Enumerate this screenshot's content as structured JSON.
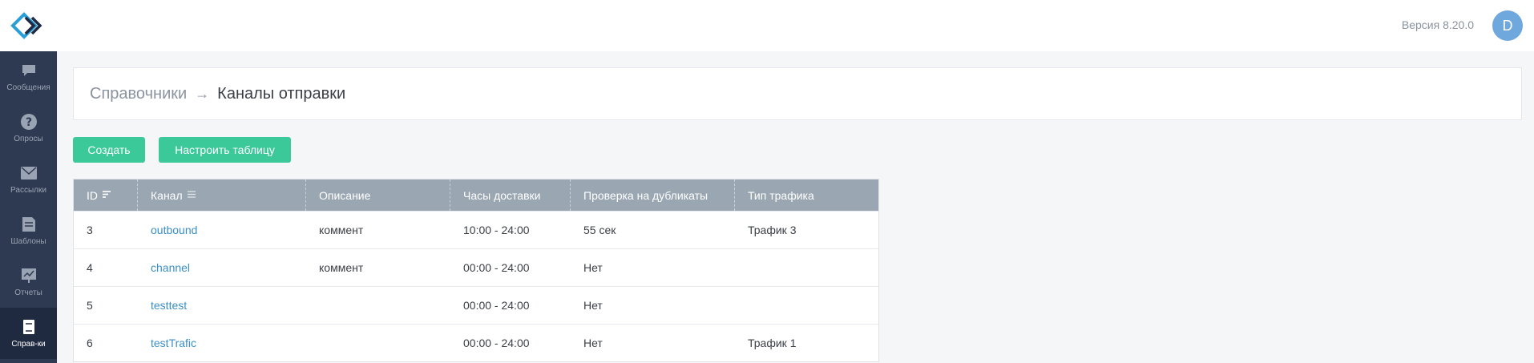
{
  "sidebar": {
    "items": [
      {
        "label": "Сообщения",
        "icon": "chat-bubble-icon"
      },
      {
        "label": "Опросы",
        "icon": "question-circle-icon"
      },
      {
        "label": "Рассылки",
        "icon": "envelope-icon"
      },
      {
        "label": "Шаблоны",
        "icon": "document-icon"
      },
      {
        "label": "Отчеты",
        "icon": "chart-board-icon"
      },
      {
        "label": "Справ-ки",
        "icon": "book-icon",
        "active": true
      }
    ]
  },
  "header": {
    "version": "Версия 8.20.0",
    "avatar_letter": "D"
  },
  "breadcrumb": {
    "parent": "Справочники",
    "arrow": "→",
    "current": "Каналы отправки"
  },
  "toolbar": {
    "create_label": "Создать",
    "settings_label": "Настроить таблицу"
  },
  "table": {
    "columns": [
      "ID",
      "Канал",
      "Описание",
      "Часы доставки",
      "Проверка на дубликаты",
      "Тип трафика"
    ],
    "rows": [
      {
        "id": "3",
        "channel": "outbound",
        "description": "коммент",
        "hours": "10:00 - 24:00",
        "duplicates": "55 сек",
        "traffic": "Трафик 3"
      },
      {
        "id": "4",
        "channel": "channel",
        "description": "коммент",
        "hours": "00:00 - 24:00",
        "duplicates": "Нет",
        "traffic": ""
      },
      {
        "id": "5",
        "channel": "testtest",
        "description": "",
        "hours": "00:00 - 24:00",
        "duplicates": "Нет",
        "traffic": ""
      },
      {
        "id": "6",
        "channel": "testTrafic",
        "description": "",
        "hours": "00:00 - 24:00",
        "duplicates": "Нет",
        "traffic": "Трафик 1"
      }
    ]
  },
  "colors": {
    "sidebar_bg": "#2e3a52",
    "accent_green": "#3cc99a",
    "link_blue": "#3b8fc4",
    "table_header": "#9aa7b3",
    "avatar": "#6fa8dc"
  }
}
